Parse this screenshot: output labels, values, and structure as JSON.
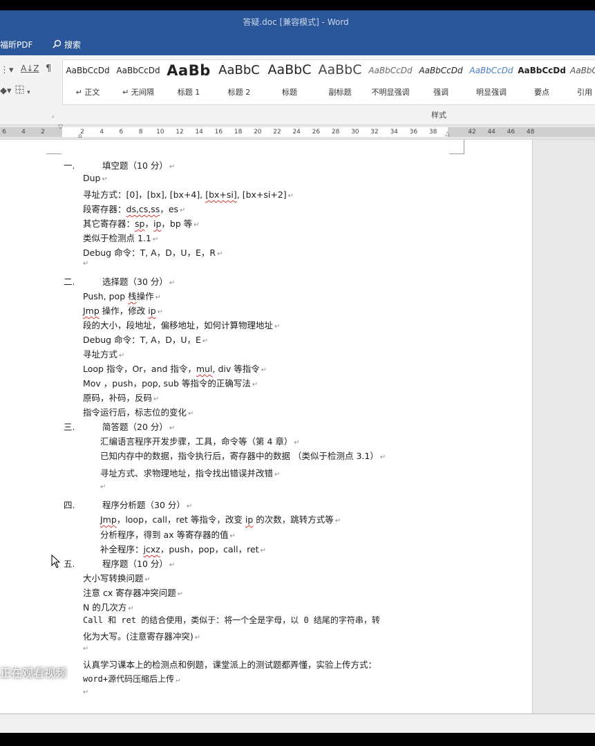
{
  "window": {
    "title": "答疑.doc [兼容模式]  -  Word"
  },
  "tabs": {
    "foxit_pdf": "福昕PDF",
    "search": "搜索"
  },
  "ribbon": {
    "styles": [
      {
        "sample": "AaBbCcDd",
        "name": "↵ 正文"
      },
      {
        "sample": "AaBbCcDd",
        "name": "↵ 无间隔"
      },
      {
        "sample": "AaBb",
        "name": "标题 1"
      },
      {
        "sample": "AaBbC",
        "name": "标题 2"
      },
      {
        "sample": "AaBbC",
        "name": "标题"
      },
      {
        "sample": "AaBbC",
        "name": "副标题"
      },
      {
        "sample": "AaBbCcDd",
        "name": "不明显强调"
      },
      {
        "sample": "AaBbCcDd",
        "name": "强调"
      },
      {
        "sample": "AaBbCcDd",
        "name": "明显强调"
      },
      {
        "sample": "AaBbCcDd",
        "name": "要点"
      },
      {
        "sample": "AaBbC",
        "name": "引用"
      }
    ],
    "group_label": "样式",
    "sort_glyph": "A↓Z",
    "pilcrow": "¶"
  },
  "ruler": {
    "left_ticks": [
      "6",
      "4",
      "2"
    ],
    "ticks": [
      "2",
      "4",
      "6",
      "8",
      "10",
      "12",
      "14",
      "16",
      "18",
      "20",
      "22",
      "24",
      "26",
      "28",
      "30",
      "32",
      "34",
      "36",
      "38"
    ],
    "right_ticks": [
      "42",
      "44",
      "46",
      "48"
    ]
  },
  "document": {
    "sec1": {
      "num": "一.",
      "title": "填空题（10 分）"
    },
    "s1_l1": "Dup",
    "s1_l2_a": "寻址方式：[0]，[bx], [bx+4], ",
    "s1_l2_b": "[bx+si]",
    "s1_l2_c": ", [bx+si+2]",
    "s1_l3_a": "段寄存器：",
    "s1_l3_b": "ds,cs,ss",
    "s1_l3_c": "，es",
    "s1_l4_a": "其它寄存器：",
    "s1_l4_b": "sp",
    "s1_l4_c": "，",
    "s1_l4_d": "ip",
    "s1_l4_e": "，bp 等",
    "s1_l5": "类似于检测点 1.1",
    "s1_l6": "Debug 命令：T,   A，D，U，E，R",
    "sec2": {
      "num": "二.",
      "title": "选择题（30 分）"
    },
    "s2_l1_a": "Push, pop  ",
    "s2_l1_b": "栈",
    "s2_l1_c": "操作",
    "s2_l2_a": "Jmp",
    "s2_l2_b": " 操作，修改 ",
    "s2_l2_c": "ip",
    "s2_l3": "段的大小，段地址，偏移地址，如何计算物理地址",
    "s2_l4": "Debug 命令：T,   A，D，U，E",
    "s2_l5": "寻址方式",
    "s2_l6_a": "Loop 指令，Or，and 指令，",
    "s2_l6_b": "mul",
    "s2_l6_c": ", div 等指令",
    "s2_l7": "Mov  ，push，pop, sub 等指令的正确写法",
    "s2_l8": "原码，补码，反码",
    "s2_l9": "指令运行后，标志位的变化",
    "sec3": {
      "num": "三.",
      "title": "简答题（20 分）"
    },
    "s3_l1": "汇编语言程序开发步骤，工具，命令等（第 4 章）",
    "s3_l2": "已知内存中的数据，指令执行后，寄存器中的数据 （类似于检测点 3.1）",
    "s3_l3": "寻址方式、求物理地址，指令找出错误并改错",
    "sec4": {
      "num": "四.",
      "title": "程序分析题（30 分）"
    },
    "s4_l1_a": "Jmp",
    "s4_l1_b": "，loop，call，ret 等指令，改变 ",
    "s4_l1_c": "ip",
    "s4_l1_d": " 的次数，跳转方式等",
    "s4_l2": "分析程序，得到 ax 等寄存器的值",
    "s4_l3_a": "补全程序：",
    "s4_l3_b": "jcxz",
    "s4_l3_c": "，push，pop，call，ret",
    "sec5": {
      "num": "五.",
      "title": "程序题（10 分）"
    },
    "s5_l1": "大小写转换问题",
    "s5_l2": "注意 cx 寄存器冲突问题",
    "s5_l3": "N 的几次方",
    "s5_l4": "Call 和 ret 的结合使用，类似于：将一个全是字母，以 0 结尾的字符串，转",
    "s5_l5": "化为大写。(注意寄存器冲突)",
    "s5_l6": "认真学习课本上的检测点和例题，课堂派上的测试题都弄懂，实验上传方式：",
    "s5_l7": "word+源代码压缩后上传",
    "para_mark": "↵"
  },
  "overlay": {
    "watching": "正在观看视频"
  }
}
